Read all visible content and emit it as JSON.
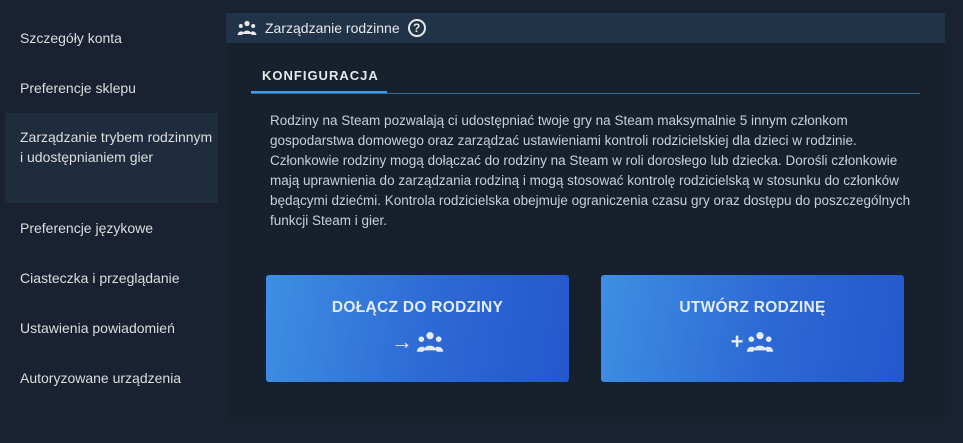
{
  "sidebar": {
    "items": [
      {
        "label": "Szczegóły konta"
      },
      {
        "label": "Preferencje sklepu"
      },
      {
        "label": "Zarządzanie trybem rodzinnym i udostępnianiem gier",
        "active": true
      },
      {
        "label": "Preferencje językowe"
      },
      {
        "label": "Ciasteczka i przeglądanie"
      },
      {
        "label": "Ustawienia powiadomień"
      },
      {
        "label": "Autoryzowane urządzenia"
      }
    ]
  },
  "panel": {
    "title": "Zarządzanie rodzinne",
    "help_icon": "?",
    "header_icon": "family-icon",
    "tab_label": "KONFIGURACJA",
    "paragraph1": "Rodziny na Steam pozwalają ci udostępniać twoje gry na Steam maksymalnie 5 innym członkom gospodarstwa domowego oraz zarządzać ustawieniami kontroli rodzicielskiej dla dzieci w rodzinie.",
    "paragraph2": "Członkowie rodziny mogą dołączać do rodziny na Steam w roli dorosłego lub dziecka. Dorośli członkowie mają uprawnienia do zarządzania rodziną i mogą stosować kontrolę rodzicielską w stosunku do członków będącymi dziećmi. Kontrola rodzicielska obejmuje ograniczenia czasu gry oraz dostępu do poszczególnych funkcji Steam i gier.",
    "join_button": {
      "label": "DOŁĄCZ DO RODZINY",
      "glyph": "→",
      "icon": "family-icon"
    },
    "create_button": {
      "label": "UTWÓRZ RODZINĘ",
      "glyph": "+",
      "icon": "family-icon"
    }
  },
  "colors": {
    "page_bg": "#1a2231",
    "panel_bg": "#17202d",
    "header_bg": "#213348",
    "accent": "#3a9be8",
    "button_gradient_start": "#3e8fe3",
    "button_gradient_end": "#2358cc"
  }
}
